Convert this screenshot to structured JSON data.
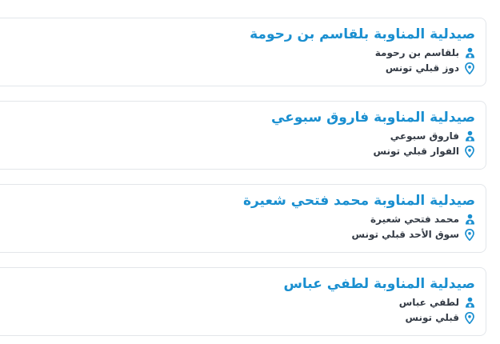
{
  "accent_color": "#1a8fd0",
  "text_color": "#333a44",
  "pharmacies": [
    {
      "title": "صيدلية المناوبة بلقاسم بن رحومة",
      "owner": "بلقاسم بن رحومة",
      "address": "دوز قبلي تونس",
      "owner_icon": "pharmacist-icon",
      "address_icon": "location-pin-icon"
    },
    {
      "title": "صيدلية المناوبة فاروق سبوعي",
      "owner": "فاروق سبوعي",
      "address": "الفوار قبلي تونس",
      "owner_icon": "pharmacist-icon",
      "address_icon": "location-pin-icon"
    },
    {
      "title": "صيدلية المناوبة محمد فتحي شعيرة",
      "owner": "محمد فتحي شعيرة",
      "address": "سوق الأحد قبلي تونس",
      "owner_icon": "pharmacist-icon",
      "address_icon": "location-pin-icon"
    },
    {
      "title": "صيدلية المناوبة لطفي عباس",
      "owner": "لطفي عباس",
      "address": "قبلي تونس",
      "owner_icon": "pharmacist-icon",
      "address_icon": "location-pin-icon"
    }
  ]
}
